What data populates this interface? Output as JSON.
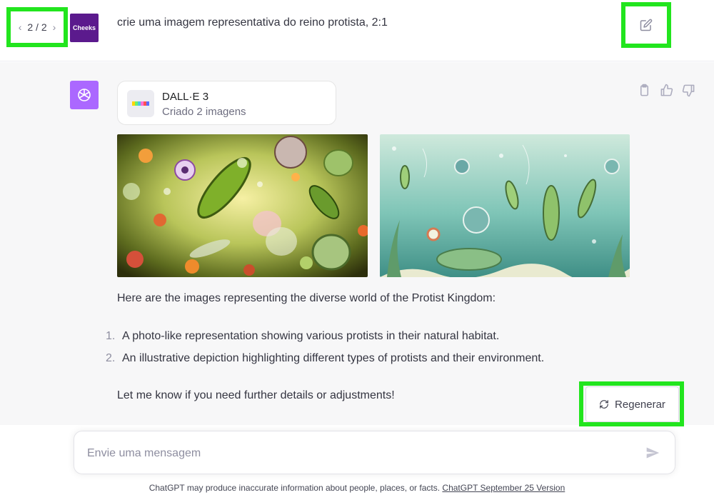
{
  "user_message": {
    "pager": {
      "prev_icon": "chevron-left-icon",
      "label": "2 / 2",
      "next_icon": "chevron-right-icon"
    },
    "avatar_label": "Cheeks",
    "avatar_color": "#5b1a8d",
    "text": "crie uma imagem representativa do reino protista, 2:1",
    "edit_icon": "edit-icon"
  },
  "assistant": {
    "avatar_color": "#ab68ff",
    "tool_card": {
      "title": "DALL·E 3",
      "subtitle": "Criado 2 imagens"
    },
    "actions": [
      "copy-icon",
      "thumbs-up-icon",
      "thumbs-down-icon"
    ],
    "images": [
      {
        "name": "protist-photo-like-image"
      },
      {
        "name": "protist-illustration-image"
      }
    ],
    "intro": "Here are the images representing the diverse world of the Protist Kingdom:",
    "list": [
      {
        "num": "1.",
        "text": "A photo-like representation showing various protists in their natural habitat."
      },
      {
        "num": "2.",
        "text": "An illustrative depiction highlighting different types of protists and their environment."
      }
    ],
    "outro": "Let me know if you need further details or adjustments!"
  },
  "regenerate_label": "Regenerar",
  "composer": {
    "placeholder": "Envie uma mensagem"
  },
  "footer": {
    "text": "ChatGPT may produce inaccurate information about people, places, or facts.",
    "link": "ChatGPT September 25 Version"
  },
  "colors": {
    "highlight": "#22e51e",
    "assistant_bg": "#f7f7f8"
  }
}
